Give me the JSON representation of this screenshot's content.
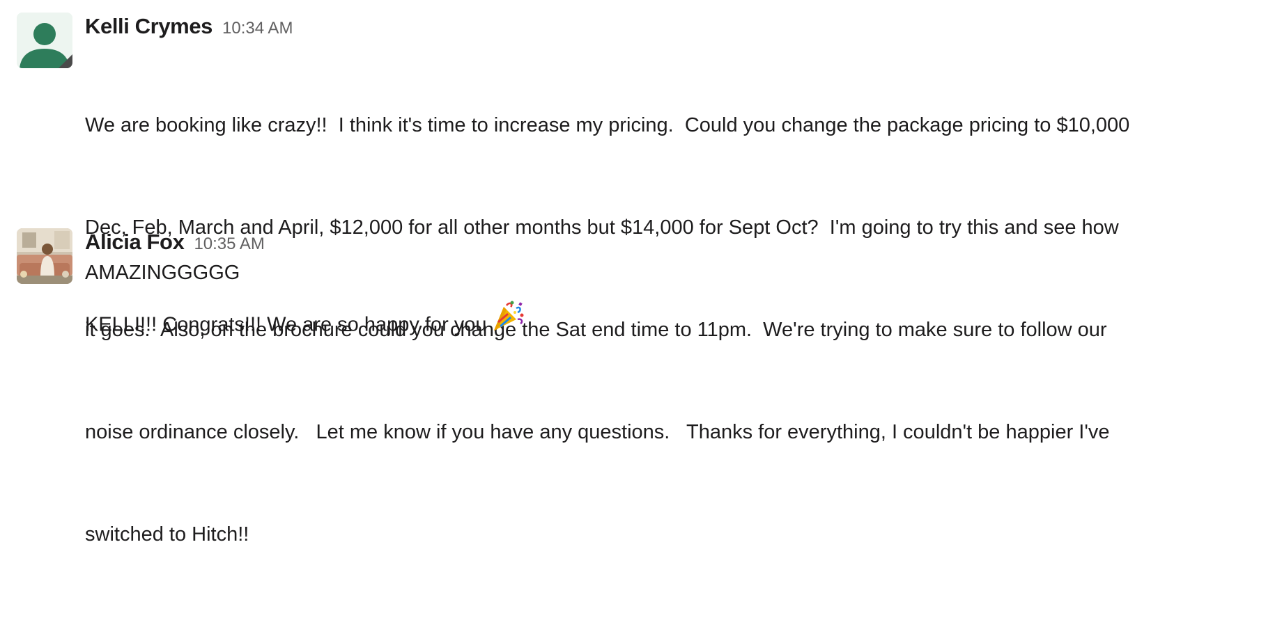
{
  "messages": [
    {
      "sender": "Kelli Crymes",
      "time": "10:34 AM",
      "avatar": "default-user-avatar",
      "avatar_color": "#2e7d5b",
      "lines": [
        "We are booking like crazy!!  I think it's time to increase my pricing.  Could you change the package pricing to $10,000",
        "Dec, Feb, March and April, $12,000 for all other months but $14,000 for Sept Oct?  I'm going to try this and see how",
        "it goes.  Also, on the brochure could you change the Sat end time to 11pm.  We're trying to make sure to follow our",
        "noise ordinance closely.   Let me know if you have any questions.   Thanks for everything, I couldn't be happier I've",
        "switched to Hitch!!"
      ]
    },
    {
      "sender": "Alicia Fox",
      "time": "10:35 AM",
      "avatar": "user-photo-avatar",
      "text1": "AMAZINGGGGG",
      "text2": "KELLI!!! Congrats!!! We are so happy for you",
      "emoji": "party-popper-emoji"
    }
  ]
}
